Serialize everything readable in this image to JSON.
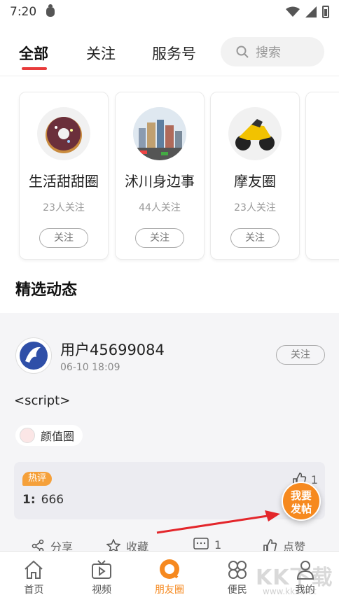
{
  "status_bar": {
    "time": "7:20"
  },
  "tabs": [
    {
      "label": "全部",
      "active": true
    },
    {
      "label": "关注",
      "active": false
    },
    {
      "label": "服务号",
      "active": false
    }
  ],
  "search": {
    "placeholder": "搜索"
  },
  "circles": [
    {
      "name": "生活甜甜圈",
      "fans": "23人关注",
      "follow_label": "关注",
      "icon": "donut-icon"
    },
    {
      "name": "沭川身边事",
      "fans": "44人关注",
      "follow_label": "关注",
      "icon": "city-icon"
    },
    {
      "name": "摩友圈",
      "fans": "23人关注",
      "follow_label": "关注",
      "icon": "motorcycle-icon"
    }
  ],
  "section_title": "精选动态",
  "post": {
    "username": "用户45699084",
    "time": "06-10 18:09",
    "follow_label": "关注",
    "text": "<script>",
    "circle_tag": "颜值圈",
    "hot_badge": "热评",
    "hot_comment_index": "1:",
    "hot_comment_text": "666",
    "like_count": "1"
  },
  "actions": [
    {
      "label": "分享",
      "icon": "share-icon"
    },
    {
      "label": "收藏",
      "icon": "star-icon"
    },
    {
      "label": "1",
      "icon": "comment-icon"
    },
    {
      "label": "点赞",
      "icon": "thumbs-up-icon"
    }
  ],
  "fab": {
    "line1": "我要",
    "line2": "发帖"
  },
  "bottom_nav": [
    {
      "label": "首页",
      "icon": "home-icon",
      "active": false
    },
    {
      "label": "视频",
      "icon": "tv-icon",
      "active": false
    },
    {
      "label": "朋友圈",
      "icon": "chat-bubble-icon",
      "active": true
    },
    {
      "label": "便民",
      "icon": "grid-icon",
      "active": false
    },
    {
      "label": "我的",
      "icon": "user-icon",
      "active": false
    }
  ],
  "watermark": {
    "text": "KK下载",
    "url": "www.kkx.net"
  },
  "colors": {
    "accent": "#f6891f",
    "tab_underline": "#e83b3b",
    "hot_badge": "#f5a03a"
  }
}
